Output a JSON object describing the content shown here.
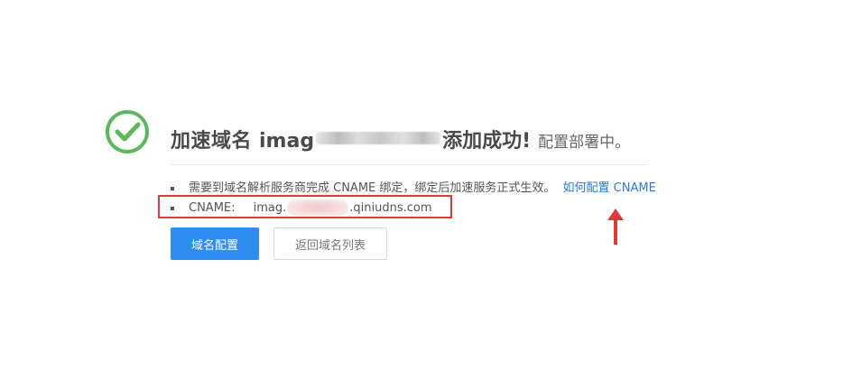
{
  "header": {
    "title_prefix": "加速域名",
    "domain_visible_start": "imag",
    "title_suffix": "添加成功!",
    "status": "配置部署中。"
  },
  "info": {
    "items": [
      {
        "text": "需要到域名解析服务商完成 CNAME 绑定，绑定后加速服务正式生效。",
        "link_label": "如何配置 CNAME"
      },
      {
        "label": "CNAME:",
        "value_start": "imag.",
        "value_end": ".qiniudns.com"
      }
    ]
  },
  "buttons": {
    "primary_label": "域名配置",
    "secondary_label": "返回域名列表"
  },
  "icons": {
    "success": "check-circle-icon",
    "annotation": "red-arrow-up-icon",
    "bullet": "square-bullet-icon"
  },
  "colors": {
    "success_green": "#5cb85c",
    "primary_blue": "#2f8cf0",
    "link_blue": "#2b7bd6",
    "annotation_red": "#e23a3a"
  }
}
